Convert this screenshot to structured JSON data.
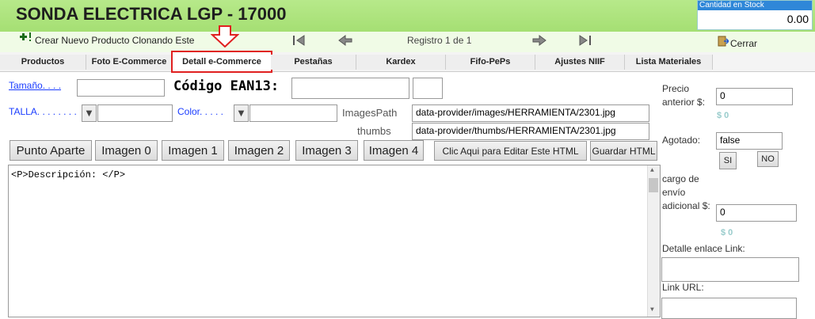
{
  "header": {
    "title": "SONDA ELECTRICA LGP - 17000",
    "stock_label": "Cantidad en Stock",
    "stock_value": "0.00"
  },
  "toolbar": {
    "clone_label": "Crear Nuevo Producto Clonando Este",
    "record_label": "Registro 1 de 1",
    "close_label": "Cerrar"
  },
  "tabs": [
    {
      "label": "Productos"
    },
    {
      "label": "Foto E-Commerce"
    },
    {
      "label": "Detall e-Commerce"
    },
    {
      "label": "Pestañas"
    },
    {
      "label": "Kardex"
    },
    {
      "label": "Fifo-PePs"
    },
    {
      "label": "Ajustes NIIF"
    },
    {
      "label": "Lista Materiales"
    }
  ],
  "form": {
    "tamano_label": "Tamaño. . . .",
    "codigo_label": "Código EAN13:",
    "talla_label": "TALLA. . . . . . . .",
    "color_label": "Color. . . . .",
    "images_path_label": "ImagesPath",
    "images_path_value": "data-provider/images/HERRAMIENTA/2301.jpg",
    "thumbs_label": "thumbs",
    "thumbs_value": "data-provider/thumbs/HERRAMIENTA/2301.jpg"
  },
  "buttons": {
    "punto_aparte": "Punto Aparte",
    "imagen0": "Imagen 0",
    "imagen1": "Imagen 1",
    "imagen2": "Imagen 2",
    "imagen3": "Imagen 3",
    "imagen4": "Imagen 4",
    "edit_html": "Clic Aqui para Editar Este HTML",
    "save_html": "Guardar HTML"
  },
  "editor": {
    "content": "<P>Descripción: </P>"
  },
  "right_panel": {
    "precio_anterior_label": "Precio anterior $:",
    "precio_anterior_value": "0",
    "precio_anterior_zero": "$ 0",
    "agotado_label": "Agotado:",
    "agotado_value": "false",
    "si_label": "SI",
    "no_label": "NO",
    "cargo_label": "cargo de envío adicional $:",
    "cargo_value": "0",
    "cargo_zero": "$ 0",
    "detalle_link_label": "Detalle enlace Link:",
    "link_url_label": "Link URL:"
  },
  "colors": {
    "header_green": "#a5df73",
    "active_tab_border": "#e02020",
    "label_blue": "#1a3cff",
    "stock_label_bg": "#2f87d8"
  }
}
